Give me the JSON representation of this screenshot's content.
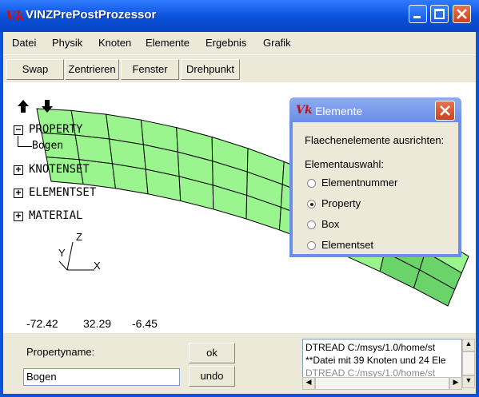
{
  "window": {
    "logo": "Vk",
    "title": "VINZPrePostProzessor"
  },
  "menu": [
    "Datei",
    "Physik",
    "Knoten",
    "Elemente",
    "Ergebnis",
    "Grafik"
  ],
  "toolbar": [
    "Swap",
    "Zentrieren",
    "Fenster",
    "Drehpunkt"
  ],
  "tree": {
    "property": "PROPERTY",
    "property_child": "Bogen",
    "knotenset": "KNOTENSET",
    "elementset": "ELEMENTSET",
    "material": "MATERIAL"
  },
  "axes": {
    "x": "X",
    "y": "Y",
    "z": "Z"
  },
  "coords": [
    "-72.42",
    "32.29",
    "-6.45"
  ],
  "dialog": {
    "logo": "Vk",
    "title": "Elemente",
    "heading": "Flaechenelemente ausrichten:",
    "group_label": "Elementauswahl:",
    "options": [
      "Elementnummer",
      "Property",
      "Box",
      "Elementset"
    ],
    "selected": "Property"
  },
  "bottom": {
    "label": "Propertyname:",
    "input_value": "Bogen",
    "ok_label": "ok",
    "undo_label": "undo",
    "log_lines": [
      "DTREAD C:/msys/1.0/home/st",
      "**Datei mit 39 Knoten und 24 Ele",
      "DTREAD C:/msys/1.0/home/st"
    ]
  },
  "colors": {
    "mesh_fill": "#9af58f",
    "mesh_dark": "#6ad46a",
    "titlebar": "#0a53e0"
  }
}
